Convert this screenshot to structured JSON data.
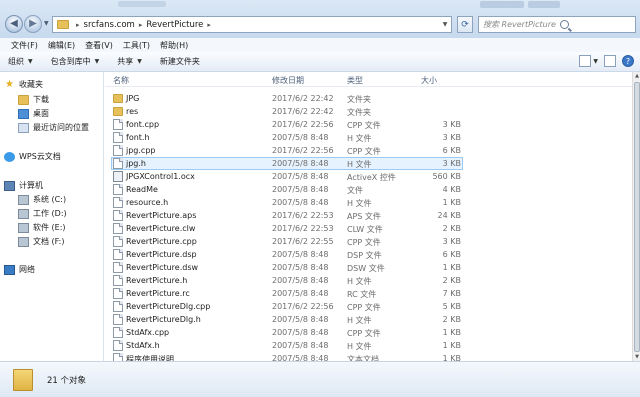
{
  "address": {
    "crumbs": [
      "srcfans.com",
      "RevertPicture"
    ],
    "search_placeholder": "搜索 RevertPicture"
  },
  "menu": [
    "文件(F)",
    "编辑(E)",
    "查看(V)",
    "工具(T)",
    "帮助(H)"
  ],
  "toolbar": {
    "organize": "组织",
    "include_in_library": "包含到库中",
    "share": "共享",
    "new_folder": "新建文件夹"
  },
  "nav": {
    "favorites": "收藏夹",
    "downloads": "下载",
    "desktop": "桌面",
    "recent": "最近访问的位置",
    "wps": "WPS云文档",
    "computer": "计算机",
    "drive_c": "系统 (C:)",
    "drive_d": "工作 (D:)",
    "drive_e": "软件 (E:)",
    "drive_f": "文档 (F:)",
    "network": "网络"
  },
  "columns": {
    "name": "名称",
    "modified": "修改日期",
    "type": "类型",
    "size": "大小"
  },
  "files": [
    {
      "name": "JPG",
      "modified": "2017/6/2 22:42",
      "type": "文件夹",
      "size": "",
      "icon": "folder"
    },
    {
      "name": "res",
      "modified": "2017/6/2 22:42",
      "type": "文件夹",
      "size": "",
      "icon": "folder"
    },
    {
      "name": "font.cpp",
      "modified": "2017/6/2 22:56",
      "type": "CPP 文件",
      "size": "3 KB",
      "icon": "doc"
    },
    {
      "name": "font.h",
      "modified": "2007/5/8 8:48",
      "type": "H 文件",
      "size": "3 KB",
      "icon": "doc"
    },
    {
      "name": "jpg.cpp",
      "modified": "2017/6/2 22:56",
      "type": "CPP 文件",
      "size": "6 KB",
      "icon": "doc"
    },
    {
      "name": "jpg.h",
      "modified": "2007/5/8 8:48",
      "type": "H 文件",
      "size": "3 KB",
      "icon": "doc"
    },
    {
      "name": "JPGXControl1.ocx",
      "modified": "2007/5/8 8:48",
      "type": "ActiveX 控件",
      "size": "560 KB",
      "icon": "ocx"
    },
    {
      "name": "ReadMe",
      "modified": "2007/5/8 8:48",
      "type": "文件",
      "size": "4 KB",
      "icon": "doc"
    },
    {
      "name": "resource.h",
      "modified": "2007/5/8 8:48",
      "type": "H 文件",
      "size": "1 KB",
      "icon": "doc"
    },
    {
      "name": "RevertPicture.aps",
      "modified": "2017/6/2 22:53",
      "type": "APS 文件",
      "size": "24 KB",
      "icon": "doc"
    },
    {
      "name": "RevertPicture.clw",
      "modified": "2017/6/2 22:53",
      "type": "CLW 文件",
      "size": "2 KB",
      "icon": "doc"
    },
    {
      "name": "RevertPicture.cpp",
      "modified": "2017/6/2 22:55",
      "type": "CPP 文件",
      "size": "3 KB",
      "icon": "doc"
    },
    {
      "name": "RevertPicture.dsp",
      "modified": "2007/5/8 8:48",
      "type": "DSP 文件",
      "size": "6 KB",
      "icon": "doc"
    },
    {
      "name": "RevertPicture.dsw",
      "modified": "2007/5/8 8:48",
      "type": "DSW 文件",
      "size": "1 KB",
      "icon": "doc"
    },
    {
      "name": "RevertPicture.h",
      "modified": "2007/5/8 8:48",
      "type": "H 文件",
      "size": "2 KB",
      "icon": "doc"
    },
    {
      "name": "RevertPicture.rc",
      "modified": "2007/5/8 8:48",
      "type": "RC 文件",
      "size": "7 KB",
      "icon": "doc"
    },
    {
      "name": "RevertPictureDlg.cpp",
      "modified": "2017/6/2 22:56",
      "type": "CPP 文件",
      "size": "5 KB",
      "icon": "doc"
    },
    {
      "name": "RevertPictureDlg.h",
      "modified": "2007/5/8 8:48",
      "type": "H 文件",
      "size": "2 KB",
      "icon": "doc"
    },
    {
      "name": "StdAfx.cpp",
      "modified": "2007/5/8 8:48",
      "type": "CPP 文件",
      "size": "1 KB",
      "icon": "doc"
    },
    {
      "name": "StdAfx.h",
      "modified": "2007/5/8 8:48",
      "type": "H 文件",
      "size": "1 KB",
      "icon": "doc"
    },
    {
      "name": "程序使用说明",
      "modified": "2007/5/8 8:48",
      "type": "文本文档",
      "size": "1 KB",
      "icon": "doc"
    }
  ],
  "selected_index": 5,
  "status": {
    "count": "21 个对象"
  }
}
